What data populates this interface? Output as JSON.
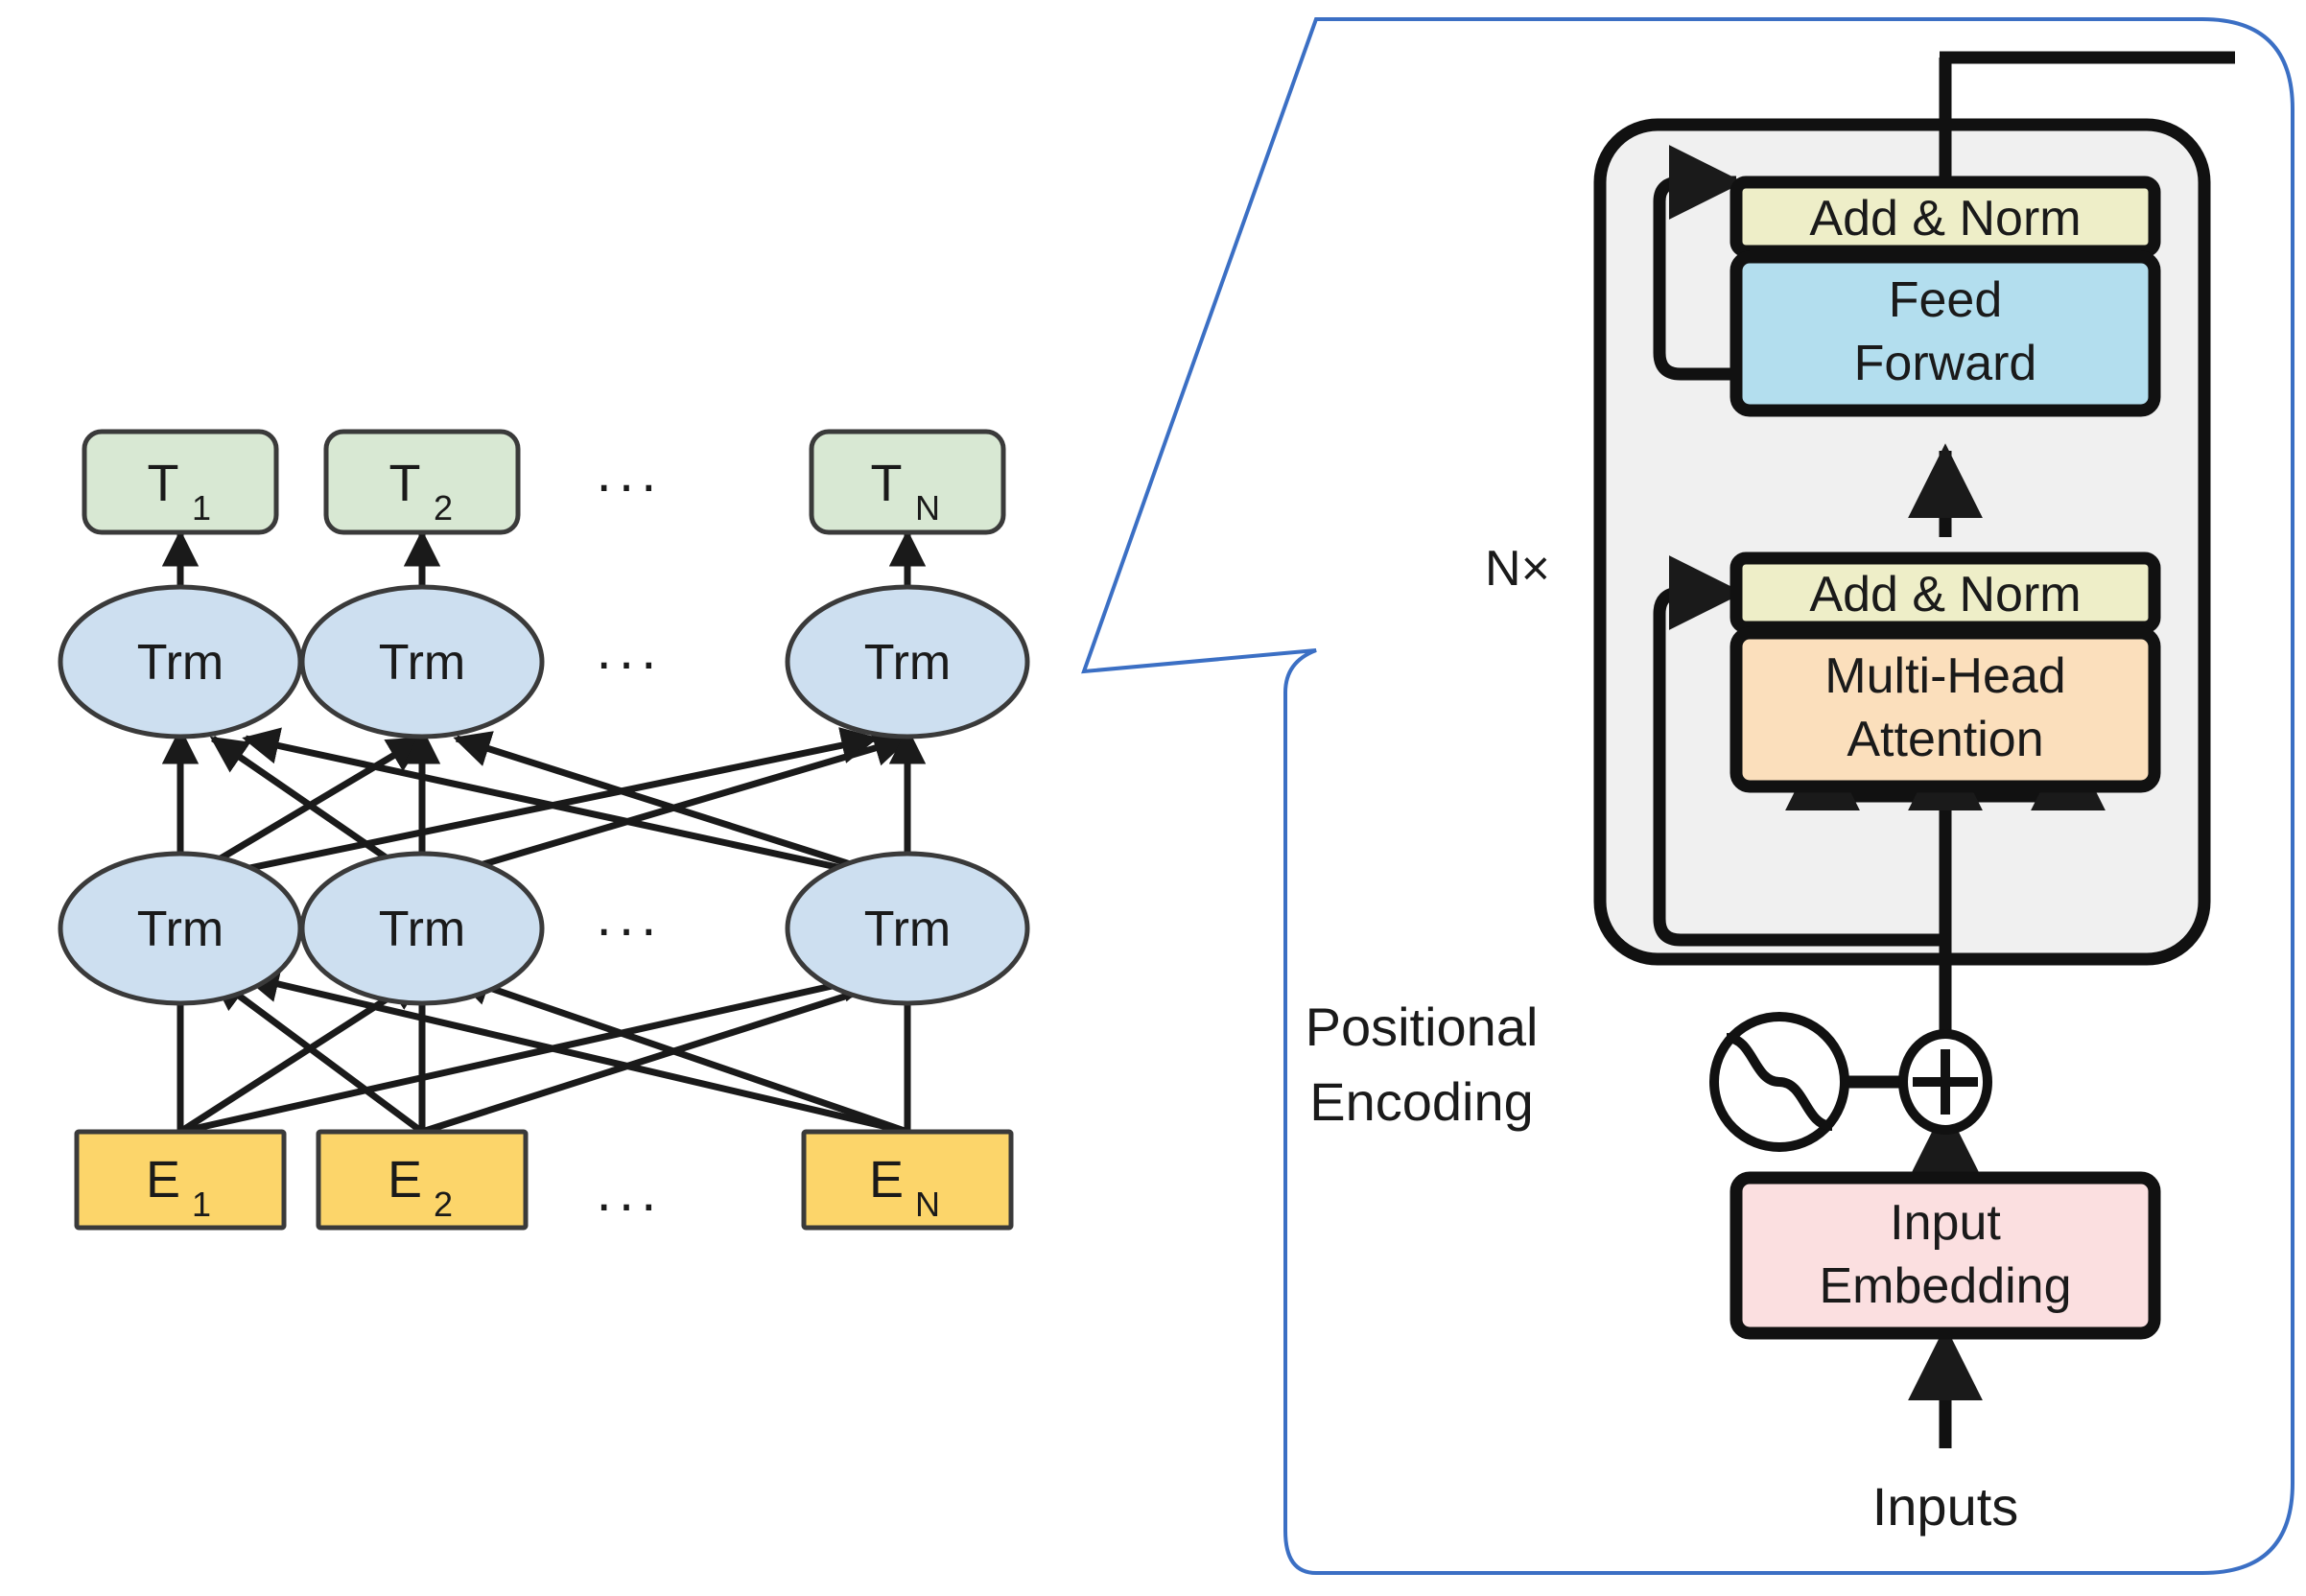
{
  "figure": {
    "title": "Transformer / BERT encoder stack diagram",
    "background_color": "#ffffff"
  },
  "colors": {
    "output_token_fill": "#d8e8d3",
    "trm_fill": "#cddff0",
    "embedding_fill": "#fcd56a",
    "add_norm_fill": "#eeeec8",
    "feed_forward_fill": "#b3deee",
    "attention_fill": "#fbdfbc",
    "input_embedding_fill": "#fbdfe0",
    "encoder_panel_fill": "#f0f0f0",
    "stroke": "#1a1a1a",
    "callout_border": "#3b6fc4"
  },
  "left_panel": {
    "name": "bert-stack",
    "outputs": [
      {
        "id": "t1",
        "base": "T",
        "sub": "1"
      },
      {
        "id": "t2",
        "base": "T",
        "sub": "2"
      },
      {
        "id": "tn",
        "base": "T",
        "sub": "N"
      }
    ],
    "layer_top": [
      {
        "id": "trm-top-1",
        "label": "Trm"
      },
      {
        "id": "trm-top-2",
        "label": "Trm"
      },
      {
        "id": "trm-top-n",
        "label": "Trm"
      }
    ],
    "layer_bottom": [
      {
        "id": "trm-bot-1",
        "label": "Trm"
      },
      {
        "id": "trm-bot-2",
        "label": "Trm"
      },
      {
        "id": "trm-bot-n",
        "label": "Trm"
      }
    ],
    "embeddings": [
      {
        "id": "e1",
        "base": "E",
        "sub": "1"
      },
      {
        "id": "e2",
        "base": "E",
        "sub": "2"
      },
      {
        "id": "en",
        "base": "E",
        "sub": "N"
      }
    ],
    "ellipsis": "···"
  },
  "right_panel": {
    "name": "transformer-encoder-callout",
    "repeat_label": "N×",
    "blocks": {
      "add_norm_top": "Add & Norm",
      "feed_forward": "Feed\nForward",
      "feed_forward_line1": "Feed",
      "feed_forward_line2": "Forward",
      "add_norm_bottom": "Add & Norm",
      "attention_line1": "Multi-Head",
      "attention_line2": "Attention",
      "input_embedding_line1": "Input",
      "input_embedding_line2": "Embedding"
    },
    "positional_encoding_line1": "Positional",
    "positional_encoding_line2": "Encoding",
    "plus_symbol": "+",
    "inputs_label": "Inputs"
  }
}
